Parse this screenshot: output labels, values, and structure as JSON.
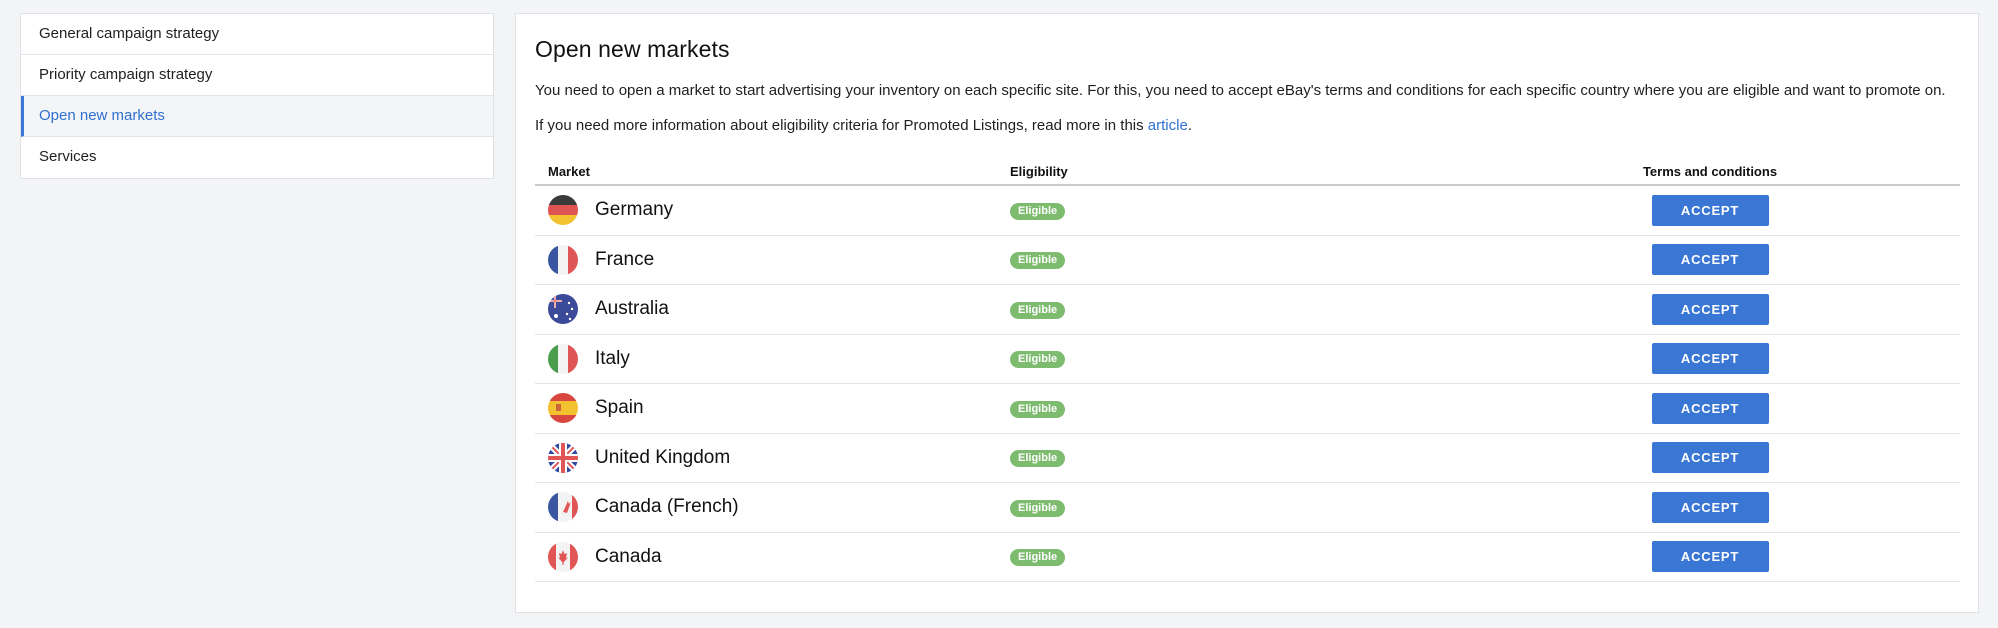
{
  "sidebar": {
    "items": [
      {
        "label": "General campaign strategy",
        "active": false
      },
      {
        "label": "Priority campaign strategy",
        "active": false
      },
      {
        "label": "Open new markets",
        "active": true
      },
      {
        "label": "Services",
        "active": false
      }
    ]
  },
  "main": {
    "title": "Open new markets",
    "paragraph1": "You need to open a market to start advertising your inventory on each specific site. For this, you need to accept eBay's terms and conditions for each specific country where you are eligible and want to promote on.",
    "paragraph2_prefix": "If you need more information about eligibility criteria for Promoted Listings, read more in this ",
    "paragraph2_link": "article",
    "paragraph2_suffix": ".",
    "table": {
      "headers": {
        "market": "Market",
        "eligibility": "Eligibility",
        "terms": "Terms and conditions"
      },
      "rows": [
        {
          "country": "Germany",
          "flag": "germany-flag-icon",
          "eligibility": "Eligible",
          "action": "ACCEPT"
        },
        {
          "country": "France",
          "flag": "france-flag-icon",
          "eligibility": "Eligible",
          "action": "ACCEPT"
        },
        {
          "country": "Australia",
          "flag": "australia-flag-icon",
          "eligibility": "Eligible",
          "action": "ACCEPT"
        },
        {
          "country": "Italy",
          "flag": "italy-flag-icon",
          "eligibility": "Eligible",
          "action": "ACCEPT"
        },
        {
          "country": "Spain",
          "flag": "spain-flag-icon",
          "eligibility": "Eligible",
          "action": "ACCEPT"
        },
        {
          "country": "United Kingdom",
          "flag": "uk-flag-icon",
          "eligibility": "Eligible",
          "action": "ACCEPT"
        },
        {
          "country": "Canada (French)",
          "flag": "canada-french-flag-icon",
          "eligibility": "Eligible",
          "action": "ACCEPT"
        },
        {
          "country": "Canada",
          "flag": "canada-flag-icon",
          "eligibility": "Eligible",
          "action": "ACCEPT"
        }
      ]
    }
  },
  "colors": {
    "accent": "#3a76d4",
    "link": "#2f6fd1",
    "eligible_badge": "#7dbb6f"
  }
}
